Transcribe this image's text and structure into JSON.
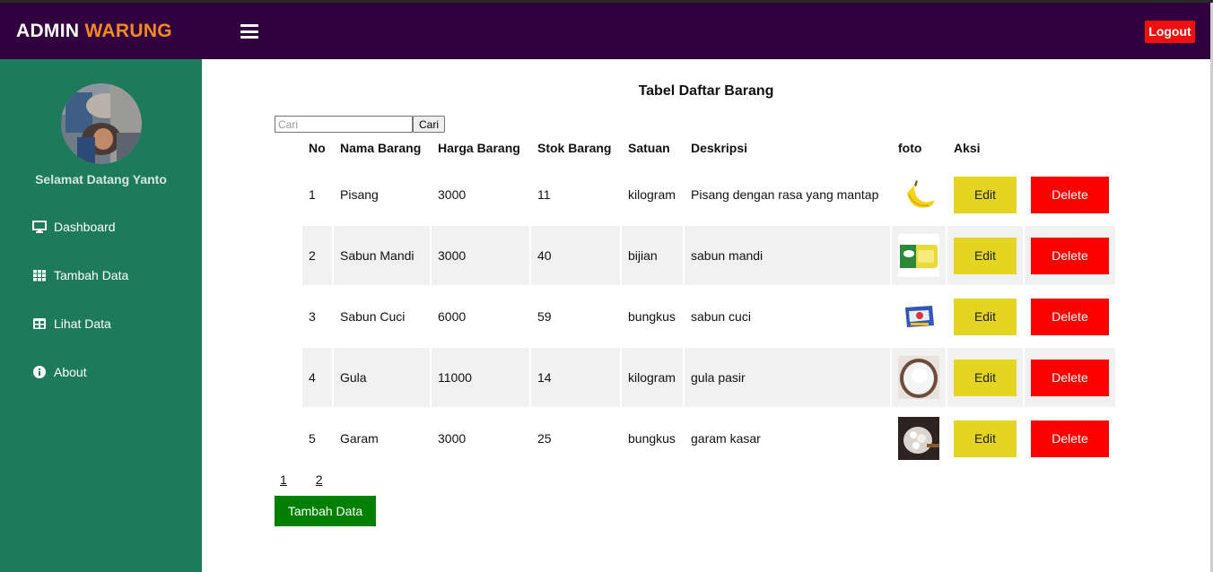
{
  "header": {
    "brand_primary": "ADMIN",
    "brand_accent": "WARUNG",
    "menu_icon": "hamburger-menu-icon",
    "logout_label": "Logout"
  },
  "sidebar": {
    "welcome": "Selamat Datang Yanto",
    "items": [
      {
        "label": "Dashboard",
        "icon": "monitor-icon"
      },
      {
        "label": "Tambah Data",
        "icon": "grid-icon"
      },
      {
        "label": "Lihat Data",
        "icon": "table-icon"
      },
      {
        "label": "About",
        "icon": "info-icon"
      }
    ]
  },
  "main": {
    "title": "Tabel Daftar Barang",
    "search": {
      "placeholder": "Cari",
      "button_label": "Cari"
    },
    "table": {
      "headers": [
        "No",
        "Nama Barang",
        "Harga Barang",
        "Stok Barang",
        "Satuan",
        "Deskripsi",
        "foto",
        "Aksi"
      ],
      "rows": [
        {
          "no": "1",
          "nama": "Pisang",
          "harga": "3000",
          "stok": "11",
          "satuan": "kilogram",
          "deskripsi": "Pisang dengan rasa yang mantap",
          "foto": "banana-photo"
        },
        {
          "no": "2",
          "nama": "Sabun Mandi",
          "harga": "3000",
          "stok": "40",
          "satuan": "bijian",
          "deskripsi": "sabun mandi",
          "foto": "soap-bar-photo"
        },
        {
          "no": "3",
          "nama": "Sabun Cuci",
          "harga": "6000",
          "stok": "59",
          "satuan": "bungkus",
          "deskripsi": "sabun cuci",
          "foto": "detergent-pack-photo"
        },
        {
          "no": "4",
          "nama": "Gula",
          "harga": "11000",
          "stok": "14",
          "satuan": "kilogram",
          "deskripsi": "gula pasir",
          "foto": "sugar-bowl-photo"
        },
        {
          "no": "5",
          "nama": "Garam",
          "harga": "3000",
          "stok": "25",
          "satuan": "bungkus",
          "deskripsi": "garam kasar",
          "foto": "coarse-salt-photo"
        }
      ],
      "edit_label": "Edit",
      "delete_label": "Delete"
    },
    "pagination": [
      "1",
      "2"
    ],
    "add_button_label": "Tambah Data"
  },
  "colors": {
    "header_bg": "#32003e",
    "sidebar_bg": "#1d7a5a",
    "brand_accent": "#f08a24",
    "logout_bg": "#ee0f0f",
    "edit_bg": "#e3d521",
    "delete_bg": "#ff0000",
    "add_bg": "#008000"
  }
}
